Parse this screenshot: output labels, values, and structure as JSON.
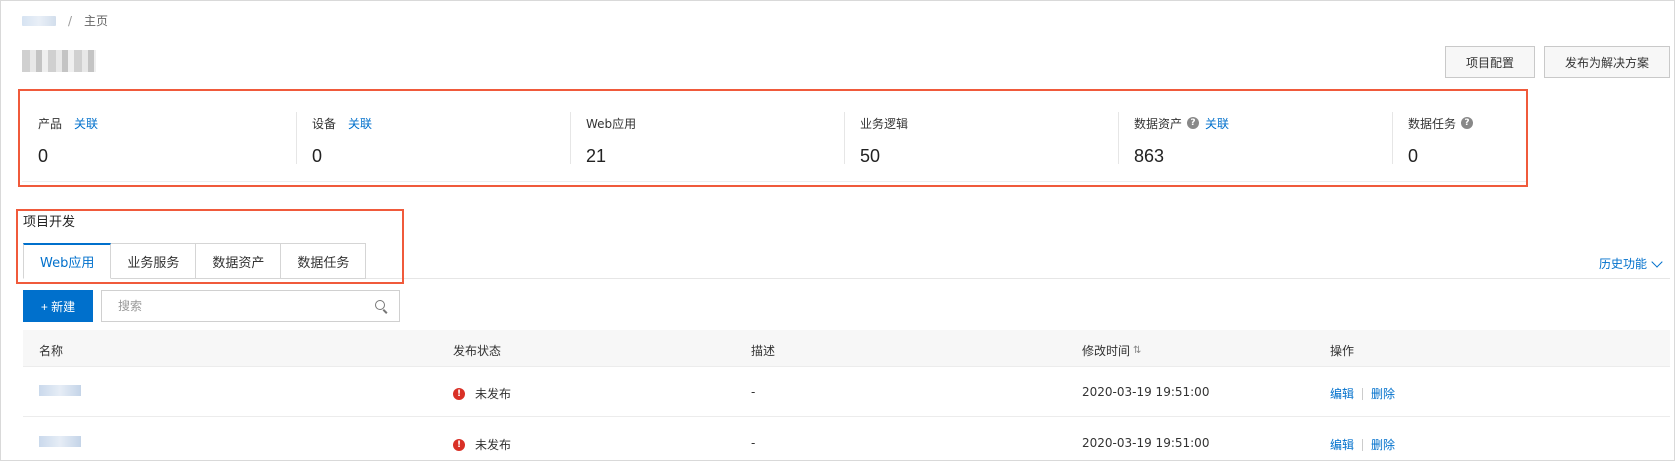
{
  "breadcrumb": {
    "current": "主页"
  },
  "header": {
    "config_button": "项目配置",
    "publish_button": "发布为解决方案"
  },
  "stats": [
    {
      "label": "产品",
      "link": "关联",
      "help": false,
      "value": "0"
    },
    {
      "label": "设备",
      "link": "关联",
      "help": false,
      "value": "0"
    },
    {
      "label": "Web应用",
      "link": "",
      "help": false,
      "value": "21"
    },
    {
      "label": "业务逻辑",
      "link": "",
      "help": false,
      "value": "50"
    },
    {
      "label": "数据资产",
      "link": "关联",
      "help": true,
      "value": "863"
    },
    {
      "label": "数据任务",
      "link": "",
      "help": true,
      "value": "0"
    }
  ],
  "section": {
    "title": "项目开发"
  },
  "tabs": [
    {
      "label": "Web应用",
      "active": true
    },
    {
      "label": "业务服务",
      "active": false
    },
    {
      "label": "数据资产",
      "active": false
    },
    {
      "label": "数据任务",
      "active": false
    }
  ],
  "history_link": "历史功能",
  "toolbar": {
    "new_button": "+ 新建",
    "search_placeholder": "搜索",
    "search_value": ""
  },
  "table": {
    "headers": {
      "name": "名称",
      "status": "发布状态",
      "desc": "描述",
      "modified": "修改时间",
      "ops": "操作"
    },
    "rows": [
      {
        "status": "未发布",
        "desc": "-",
        "modified": "2020-03-19 19:51:00",
        "edit": "编辑",
        "delete": "删除"
      },
      {
        "status": "未发布",
        "desc": "-",
        "modified": "2020-03-19 19:51:00",
        "edit": "编辑",
        "delete": "删除"
      }
    ]
  },
  "colors": {
    "accent": "#0070cc",
    "highlight_box": "#f05a3b",
    "error": "#d93026"
  }
}
